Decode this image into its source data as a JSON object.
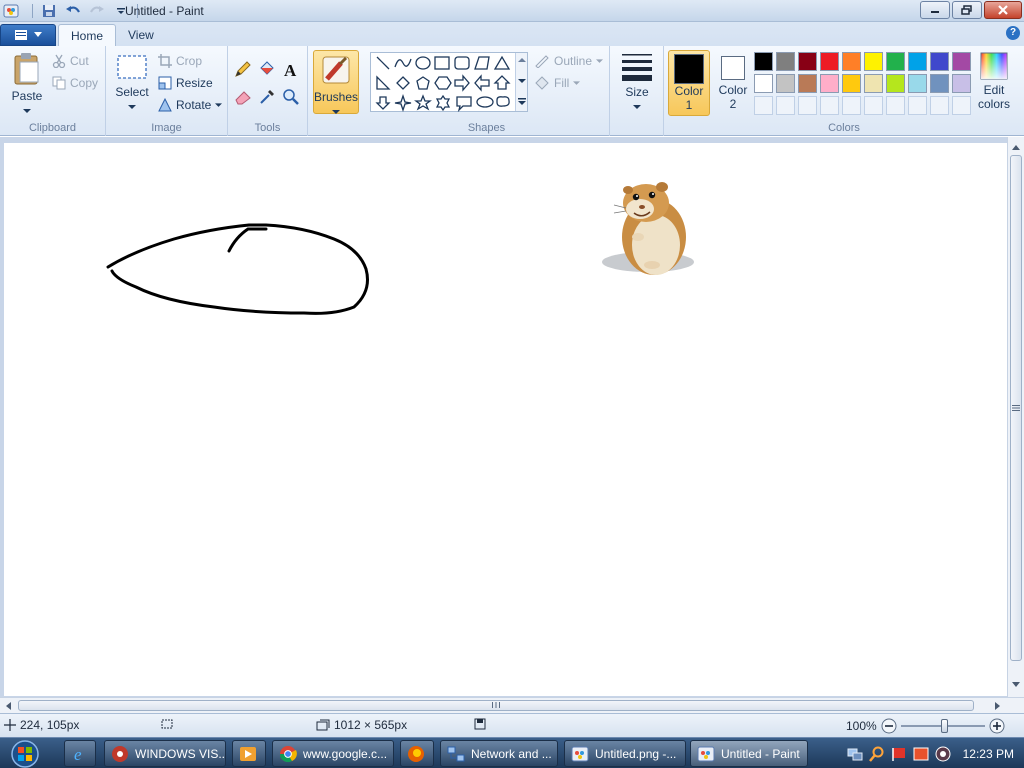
{
  "window": {
    "title": "Untitled - Paint"
  },
  "tabs": {
    "home": "Home",
    "view": "View"
  },
  "ribbon": {
    "clipboard": {
      "label": "Clipboard",
      "paste": "Paste",
      "cut": "Cut",
      "copy": "Copy"
    },
    "image": {
      "label": "Image",
      "select": "Select",
      "crop": "Crop",
      "resize": "Resize",
      "rotate": "Rotate"
    },
    "tools": {
      "label": "Tools"
    },
    "brushes": {
      "label": "Brushes"
    },
    "shapes": {
      "label": "Shapes",
      "outline": "Outline",
      "fill": "Fill"
    },
    "size": {
      "label": "Size"
    },
    "colors": {
      "label": "Colors",
      "color1_label": "Color",
      "color1_num": "1",
      "color2_label": "Color",
      "color2_num": "2",
      "edit_label": "Edit",
      "edit_label2": "colors",
      "color1": "#000000",
      "color2": "#ffffff",
      "palette_row1": [
        "#000000",
        "#7f7f7f",
        "#880015",
        "#ed1c24",
        "#ff7f27",
        "#fff200",
        "#22b14c",
        "#00a2e8",
        "#3f48cc",
        "#a349a4"
      ],
      "palette_row2": [
        "#ffffff",
        "#c3c3c3",
        "#b97a57",
        "#ffaec9",
        "#ffc90e",
        "#efe4b0",
        "#b5e61d",
        "#99d9ea",
        "#7092be",
        "#c8bfe7"
      ]
    }
  },
  "status": {
    "cursor_pos": "224, 105px",
    "image_size": "1012 × 565px",
    "zoom": "100%"
  },
  "taskbar": {
    "items": [
      "WINDOWS VIS...",
      "www.google.c...",
      "Network and ...",
      "Untitled.png -...",
      "Untitled - Paint"
    ],
    "clock": "12:23 PM"
  }
}
